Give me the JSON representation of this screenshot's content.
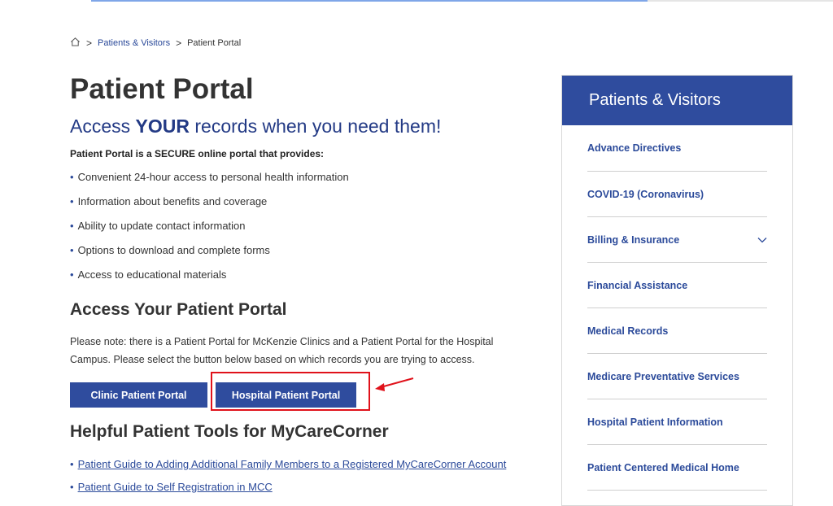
{
  "breadcrumb": {
    "home_icon": "home-icon",
    "items": [
      "Patients & Visitors",
      "Patient Portal"
    ],
    "separator": ">"
  },
  "main": {
    "title": "Patient Portal",
    "subtitle_pre": "Access ",
    "subtitle_bold": "YOUR",
    "subtitle_post": " records when you need them!",
    "intro": "Patient Portal is a SECURE online portal that provides:",
    "bullets": [
      "Convenient 24-hour access to personal health information",
      "Information about benefits and coverage",
      "Ability to update contact information",
      "Options to download and complete forms",
      "Access to educational materials"
    ],
    "access_heading": "Access Your Patient Portal",
    "note": "Please note: there is a Patient Portal for McKenzie Clinics and a Patient Portal for the Hospital Campus. Please select the button below based on which records you are trying to access.",
    "clinic_button": "Clinic Patient Portal",
    "hospital_button": "Hospital Patient Portal",
    "tools_heading": "Helpful Patient Tools for MyCareCorner",
    "links": [
      "Patient Guide to Adding Additional Family Members to a Registered MyCareCorner Account",
      "Patient Guide to Self Registration in MCC"
    ]
  },
  "sidebar": {
    "title": "Patients & Visitors",
    "items": [
      {
        "label": "Advance Directives"
      },
      {
        "label": "COVID-19 (Coronavirus)"
      },
      {
        "label": "Billing & Insurance",
        "icon": "chevron-down-icon"
      },
      {
        "label": "Financial Assistance"
      },
      {
        "label": "Medical Records"
      },
      {
        "label": "Medicare Preventative Services"
      },
      {
        "label": "Hospital Patient Information"
      },
      {
        "label": "Patient Centered Medical Home"
      }
    ]
  },
  "colors": {
    "brand_blue": "#2f4c9e",
    "link_blue": "#2b4a9a",
    "highlight_red": "#e0121b"
  }
}
